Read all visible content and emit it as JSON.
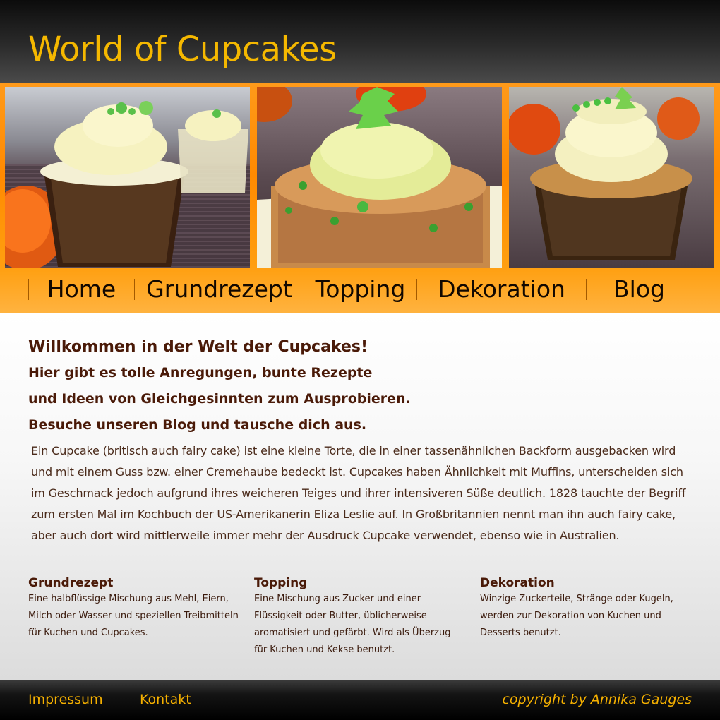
{
  "header": {
    "title": "World of Cupcakes"
  },
  "photos": [
    {
      "icon": "cupcake-photo-1"
    },
    {
      "icon": "cupcake-photo-2"
    },
    {
      "icon": "cupcake-photo-3"
    }
  ],
  "nav": {
    "items": [
      {
        "label": "Home"
      },
      {
        "label": "Grundrezept"
      },
      {
        "label": "Topping"
      },
      {
        "label": "Dekoration"
      },
      {
        "label": "Blog"
      }
    ]
  },
  "welcome": {
    "line1": "Willkommen in der Welt der Cupcakes!",
    "line2": "Hier gibt es tolle Anregungen, bunte Rezepte",
    "line3": "und Ideen von Gleichgesinnten zum Ausprobieren.",
    "line4": "Besuche unseren Blog und tausche dich aus."
  },
  "intro": {
    "text": "Ein Cupcake (britisch auch fairy cake) ist eine kleine Torte, die in einer tassenähnlichen Backform ausgebacken wird und mit einem Guss bzw. einer Cremehaube bedeckt ist. Cupcakes haben Ähnlichkeit mit Muffins, unterscheiden sich im Geschmack jedoch aufgrund ihres weicheren Teiges und ihrer intensiveren Süße deutlich. 1828 tauchte der Begriff zum ersten Mal im Kochbuch der US-Amerikanerin Eliza Leslie auf. In Großbritannien nennt man ihn auch fairy cake, aber auch dort wird mittlerweile immer mehr der Ausdruck Cupcake verwendet, ebenso wie in Australien."
  },
  "columns": [
    {
      "title": "Grundrezept",
      "text": "Eine halbflüssige Mischung aus Mehl, Eiern, Milch oder Wasser und speziellen Treibmitteln für Kuchen und Cupcakes."
    },
    {
      "title": "Topping",
      "text": "Eine Mischung aus Zucker und einer Flüssigkeit oder Butter, üblicherweise aromatisiert und gefärbt. Wird als Überzug für Kuchen und Kekse benutzt."
    },
    {
      "title": "Dekoration",
      "text": "Winzige Zuckerteile, Stränge oder Kugeln, werden zur Dekoration von Kuchen und Desserts benutzt."
    }
  ],
  "footer": {
    "impressum": "Impressum",
    "kontakt": "Kontakt",
    "copyright": "copyright by Annika Gauges"
  },
  "colors": {
    "accent": "#f5b800",
    "orange": "#ff8a00",
    "text_dark": "#4a1a08"
  }
}
